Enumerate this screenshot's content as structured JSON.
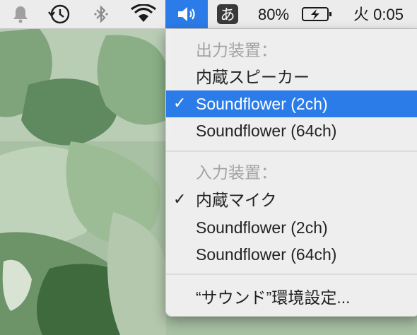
{
  "menubar": {
    "icons": [
      "notification-bell-icon",
      "time-machine-icon",
      "bluetooth-icon",
      "wifi-icon",
      "volume-icon"
    ],
    "ime_label": "あ",
    "battery_percent": "80%",
    "battery_charging": true,
    "clock": "火 0:05"
  },
  "sound_menu": {
    "output_header": "出力装置：",
    "output_devices": [
      {
        "label": "内蔵スピーカー",
        "checked": false,
        "highlighted": false
      },
      {
        "label": "Soundflower (2ch)",
        "checked": true,
        "highlighted": true
      },
      {
        "label": "Soundflower (64ch)",
        "checked": false,
        "highlighted": false
      }
    ],
    "input_header": "入力装置：",
    "input_devices": [
      {
        "label": "内蔵マイク",
        "checked": true,
        "highlighted": false
      },
      {
        "label": "Soundflower (2ch)",
        "checked": false,
        "highlighted": false
      },
      {
        "label": "Soundflower (64ch)",
        "checked": false,
        "highlighted": false
      }
    ],
    "checkmark": "✓",
    "preferences_label": "“サウンド”環境設定..."
  },
  "colors": {
    "menubar_bg": "#ececec",
    "accent": "#2b7ce9",
    "menu_bg": "#f0f0f0",
    "header_text": "#a3a3a3"
  }
}
